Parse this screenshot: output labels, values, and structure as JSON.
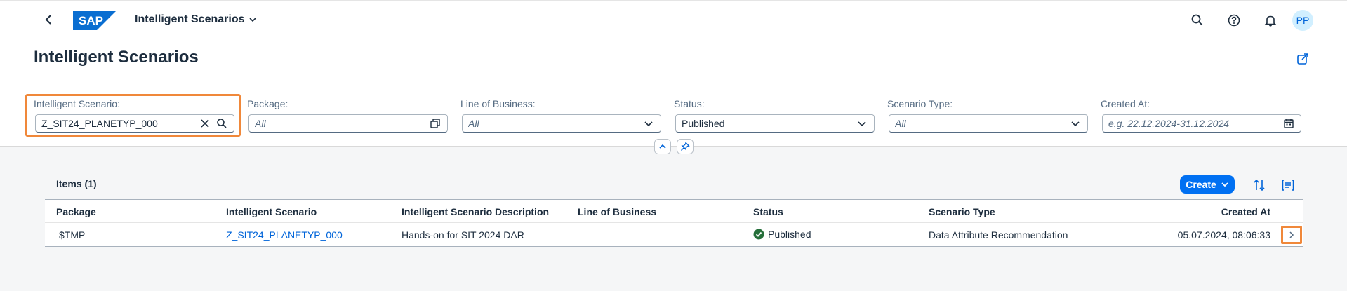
{
  "shell": {
    "back_glyph": "‹",
    "logo_text": "SAP",
    "app_title": "Intelligent Scenarios",
    "avatar_initials": "PP",
    "icons": [
      "search-icon",
      "help-icon",
      "bell-icon"
    ]
  },
  "page": {
    "title": "Intelligent Scenarios"
  },
  "filters": {
    "scenario": {
      "label": "Intelligent Scenario:",
      "value": "Z_SIT24_PLANETYP_000"
    },
    "package": {
      "label": "Package:",
      "placeholder": "All"
    },
    "lob": {
      "label": "Line of Business:",
      "placeholder": "All"
    },
    "status": {
      "label": "Status:",
      "value": "Published"
    },
    "type": {
      "label": "Scenario Type:",
      "placeholder": "All"
    },
    "created": {
      "label": "Created At:",
      "placeholder": "e.g. 22.12.2024-31.12.2024"
    }
  },
  "table": {
    "title": "Items (1)",
    "create_label": "Create",
    "columns": [
      "Package",
      "Intelligent Scenario",
      "Intelligent Scenario Description",
      "Line of Business",
      "Status",
      "Scenario Type",
      "Created At"
    ],
    "rows": [
      {
        "package": "$TMP",
        "scenario": "Z_SIT24_PLANETYP_000",
        "description": "Hands-on for SIT 2024 DAR",
        "lob": "",
        "status": "Published",
        "type": "Data Attribute Recommendation",
        "created": "05.07.2024, 08:06:33"
      }
    ]
  },
  "colors": {
    "accent": "#0070f2",
    "link": "#0064d9",
    "success": "#256f3a",
    "highlight": "#f0883a",
    "sap_blue": "#0a6ed1"
  }
}
